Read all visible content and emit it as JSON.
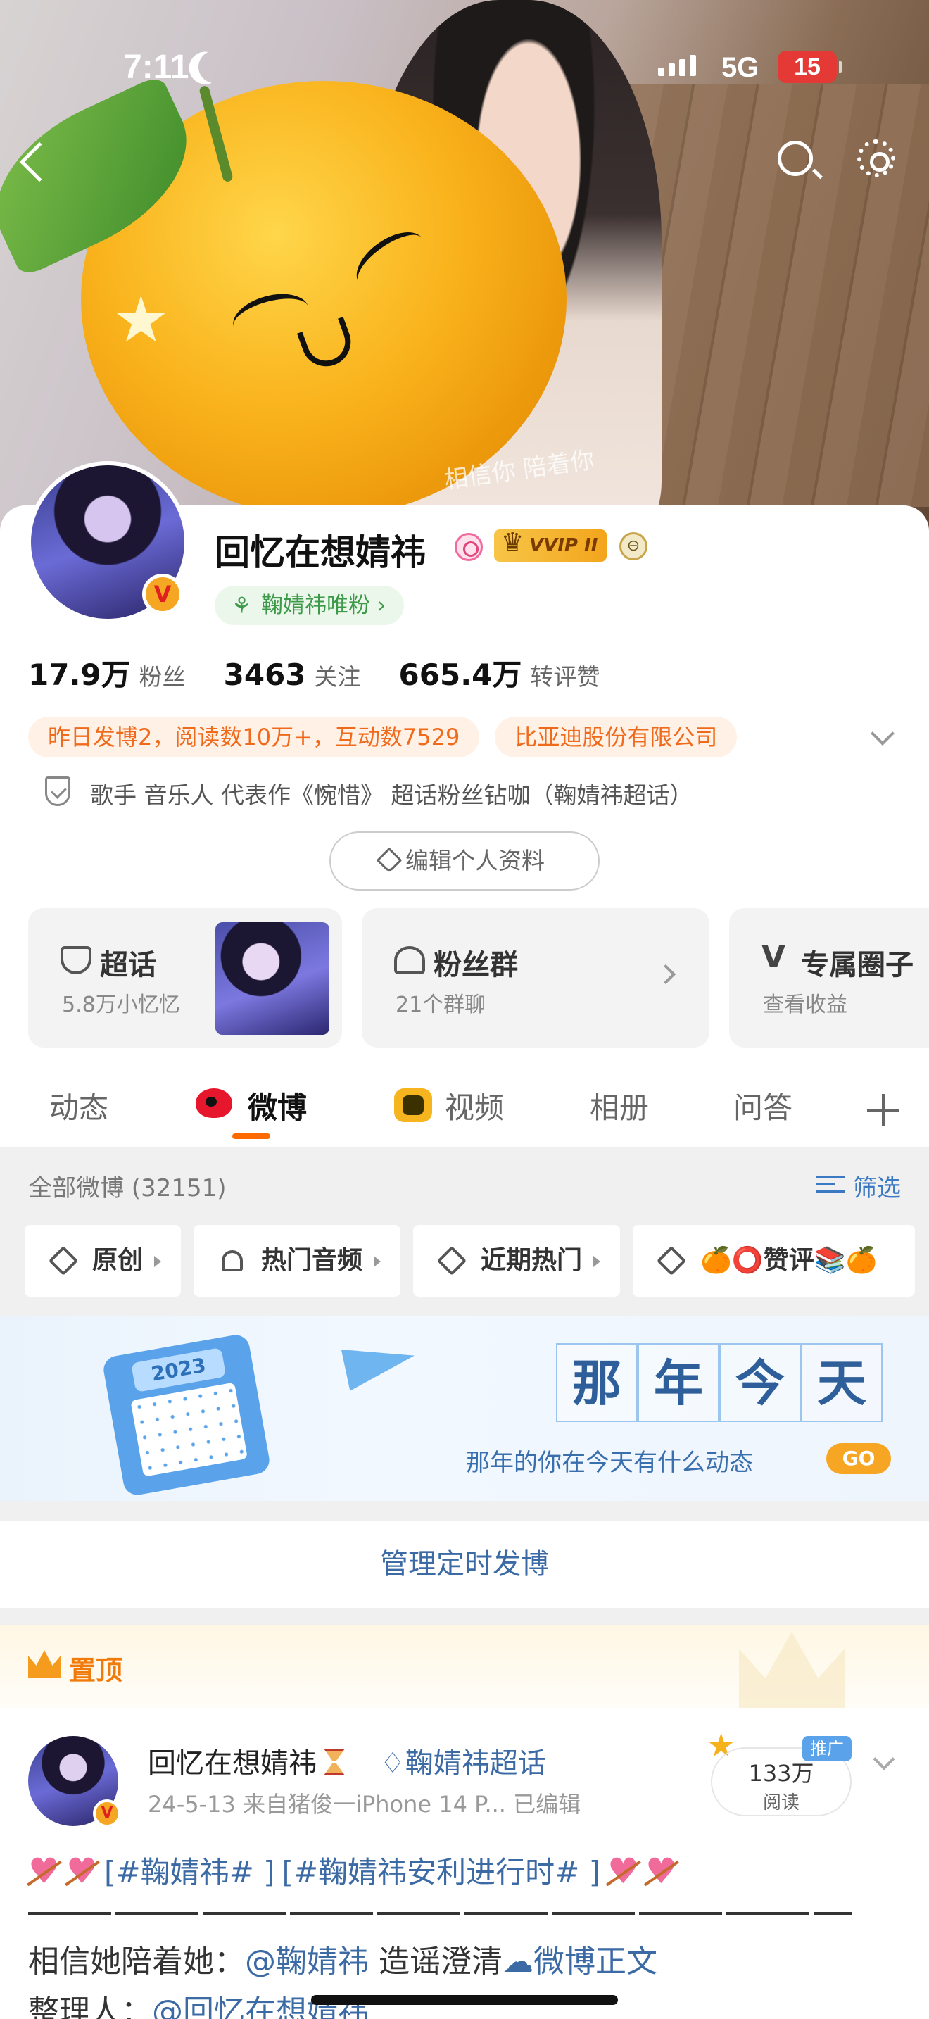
{
  "status_bar": {
    "time": "7:11",
    "network": "5G",
    "battery": "15"
  },
  "cover": {
    "caption": "相信你 陪着你"
  },
  "profile": {
    "name": "回忆在想婧祎",
    "vip_label": "VVIP II",
    "fan_badge": "鞠婧祎唯粉 ›",
    "stats": [
      {
        "num": "17.9万",
        "label": "粉丝"
      },
      {
        "num": "3463",
        "label": "关注"
      },
      {
        "num": "665.4万",
        "label": "转评赞"
      }
    ],
    "chips": [
      "昨日发博2，阅读数10万+，互动数7529",
      "比亚迪股份有限公司"
    ],
    "bio": "歌手 音乐人 代表作《惋惜》 超话粉丝钻咖（鞠婧祎超话）",
    "edit_label": "编辑个人资料"
  },
  "tiles": [
    {
      "title": "超话",
      "sub": "5.8万小忆忆"
    },
    {
      "title": "粉丝群",
      "sub": "21个群聊"
    },
    {
      "title": "专属圈子",
      "sub": "查看收益"
    }
  ],
  "tabs": [
    "动态",
    "微博",
    "视频",
    "相册",
    "问答"
  ],
  "feed": {
    "all_label": "全部微博 (32151)",
    "filter_label": "筛选",
    "filter_chips": [
      "原创",
      "热门音频",
      "近期热门",
      "🍊⭕赞评📚🍊"
    ]
  },
  "banner": {
    "year": "2023",
    "title_chars": [
      "那",
      "年",
      "今",
      "天"
    ],
    "subtitle": "那年的你在今天有什么动态",
    "go": "GO"
  },
  "manage_label": "管理定时发博",
  "pinned": {
    "label": "置顶",
    "author": "回忆在想婧祎",
    "topic": "♢鞠婧祎超话",
    "meta": "24-5-13  来自猪俊一iPhone 14 P...  已编辑",
    "reads_num": "133万",
    "reads_label": "阅读",
    "promo": "推广",
    "tag1": "[#鞠婧祎# ]",
    "tag2": "[#鞠婧祎安利进行时# ]",
    "line2_prefix": "相信她陪着她：",
    "line2_mention": "@鞠婧祎",
    "line2_mid": " 造谣澄清",
    "line2_link": "☁微博正文",
    "line3_prefix": "整理人：",
    "line3_mention": "@回忆在想婧祎"
  }
}
